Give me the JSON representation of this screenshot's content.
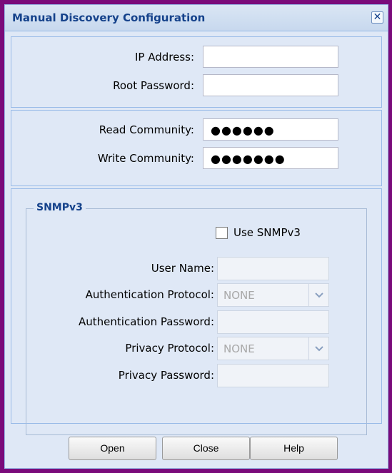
{
  "dialog": {
    "title": "Manual Discovery Configuration",
    "close_glyph": "✕"
  },
  "basic": {
    "ip_label": "IP Address:",
    "ip_value": "",
    "root_pw_label": "Root Password:",
    "root_pw_value": ""
  },
  "community": {
    "read_label": "Read Community:",
    "read_masked": "●●●●●●",
    "write_label": "Write Community:",
    "write_masked": "●●●●●●●"
  },
  "snmpv3": {
    "legend": "SNMPv3",
    "use_label": "Use SNMPv3",
    "use_checked": false,
    "user_label": "User Name:",
    "user_value": "",
    "auth_proto_label": "Authentication Protocol:",
    "auth_proto_value": "NONE",
    "auth_pw_label": "Authentication Password:",
    "auth_pw_value": "",
    "priv_proto_label": "Privacy Protocol:",
    "priv_proto_value": "NONE",
    "priv_pw_label": "Privacy Password:",
    "priv_pw_value": "",
    "dropdown_icon": "chevron-down-icon"
  },
  "buttons": {
    "open": "Open",
    "close": "Close",
    "help": "Help"
  },
  "colors": {
    "frame": "#7a0a7a",
    "title_text": "#15428b",
    "panel_bg": "#dfe8f6",
    "panel_border": "#99bbe8"
  }
}
